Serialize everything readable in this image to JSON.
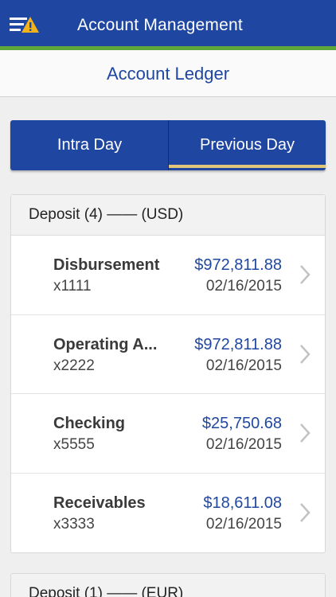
{
  "header": {
    "title": "Account Management",
    "menu_icon": "menu-alert-icon",
    "bar_color": "#1f46a0",
    "stripe_color": "#5fa63b",
    "alert_color": "#f2b21b"
  },
  "subheader": {
    "title": "Account Ledger"
  },
  "segments": [
    {
      "label": "Intra Day",
      "selected": false
    },
    {
      "label": "Previous Day",
      "selected": true
    }
  ],
  "groups": [
    {
      "title": "Deposit (4) —— (USD)",
      "accounts": [
        {
          "name": "Disbursement",
          "number": "x1111",
          "amount": "$972,811.88",
          "date": "02/16/2015"
        },
        {
          "name": "Operating A...",
          "number": "x2222",
          "amount": "$972,811.88",
          "date": "02/16/2015"
        },
        {
          "name": "Checking",
          "number": "x5555",
          "amount": "$25,750.68",
          "date": "02/16/2015"
        },
        {
          "name": "Receivables",
          "number": "x3333",
          "amount": "$18,611.08",
          "date": "02/16/2015"
        }
      ]
    },
    {
      "title": "Deposit (1) —— (EUR)",
      "accounts": []
    }
  ]
}
